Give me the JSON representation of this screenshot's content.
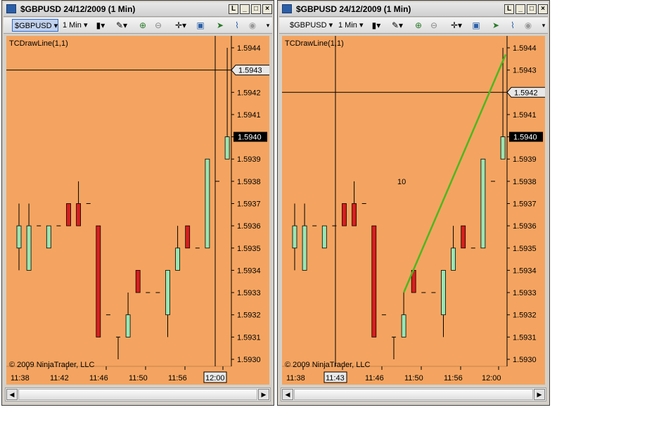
{
  "windows": [
    {
      "title": "$GBPUSD  24/12/2009 (1 Min)",
      "toolbar": {
        "symbol": "$GBPUSD",
        "interval": "1 Min"
      },
      "chart": {
        "indicator_label": "TCDrawLine(1,1)",
        "copyright": "© 2009 NinjaTrader, LLC",
        "price_ticks": [
          "1.5944",
          "1.5943",
          "1.5942",
          "1.5941",
          "1.5940",
          "1.5939",
          "1.5938",
          "1.5937",
          "1.5936",
          "1.5935",
          "1.5934",
          "1.5933",
          "1.5932",
          "1.5931",
          "1.5930"
        ],
        "time_ticks": [
          "11:38",
          "11:42",
          "11:46",
          "11:50",
          "11:56",
          "12:00"
        ],
        "current_price_label": "1.5940",
        "cursor_price_label": "1.5943",
        "cursor_time_label": "12:00",
        "annotation": ""
      }
    },
    {
      "title": "$GBPUSD  24/12/2009 (1 Min)",
      "toolbar": {
        "symbol": "$GBPUSD",
        "interval": "1 Min"
      },
      "chart": {
        "indicator_label": "TCDrawLine(1,1)",
        "copyright": "© 2009 NinjaTrader, LLC",
        "price_ticks": [
          "1.5944",
          "1.5943",
          "1.5942",
          "1.5941",
          "1.5940",
          "1.5939",
          "1.5938",
          "1.5937",
          "1.5936",
          "1.5935",
          "1.5934",
          "1.5933",
          "1.5932",
          "1.5931",
          "1.5930"
        ],
        "time_ticks": [
          "11:38",
          "11:43",
          "11:46",
          "11:50",
          "11:56",
          "12:00"
        ],
        "current_price_label": "1.5940",
        "cursor_price_label": "1.5942",
        "cursor_time_label": "11:43",
        "annotation": "10"
      }
    }
  ],
  "chart_data": [
    {
      "type": "candlestick",
      "title": "$GBPUSD 24/12/2009 (1 Min)",
      "bar_interval": "1 Min",
      "ylim": [
        1.593,
        1.5944
      ],
      "candles": [
        {
          "o": 1.5935,
          "h": 1.5937,
          "l": 1.5934,
          "c": 1.5936
        },
        {
          "o": 1.5934,
          "h": 1.5937,
          "l": 1.5934,
          "c": 1.5936
        },
        {
          "o": 1.5936,
          "h": 1.5936,
          "l": 1.5936,
          "c": 1.5936
        },
        {
          "o": 1.5935,
          "h": 1.5936,
          "l": 1.5935,
          "c": 1.5936
        },
        {
          "o": 1.5936,
          "h": 1.5936,
          "l": 1.5936,
          "c": 1.5936
        },
        {
          "o": 1.5937,
          "h": 1.5937,
          "l": 1.5936,
          "c": 1.5936
        },
        {
          "o": 1.5937,
          "h": 1.5938,
          "l": 1.5936,
          "c": 1.5936
        },
        {
          "o": 1.5937,
          "h": 1.5937,
          "l": 1.5937,
          "c": 1.5937
        },
        {
          "o": 1.5936,
          "h": 1.5936,
          "l": 1.5931,
          "c": 1.5931
        },
        {
          "o": 1.5932,
          "h": 1.5932,
          "l": 1.5932,
          "c": 1.5932
        },
        {
          "o": 1.5931,
          "h": 1.5931,
          "l": 1.593,
          "c": 1.5931
        },
        {
          "o": 1.5931,
          "h": 1.5933,
          "l": 1.5931,
          "c": 1.5932
        },
        {
          "o": 1.5934,
          "h": 1.5934,
          "l": 1.5933,
          "c": 1.5933
        },
        {
          "o": 1.5933,
          "h": 1.5933,
          "l": 1.5933,
          "c": 1.5933
        },
        {
          "o": 1.5933,
          "h": 1.5933,
          "l": 1.5933,
          "c": 1.5933
        },
        {
          "o": 1.5932,
          "h": 1.5934,
          "l": 1.5931,
          "c": 1.5934
        },
        {
          "o": 1.5934,
          "h": 1.5936,
          "l": 1.5934,
          "c": 1.5935
        },
        {
          "o": 1.5936,
          "h": 1.5936,
          "l": 1.5935,
          "c": 1.5935
        },
        {
          "o": 1.5935,
          "h": 1.5935,
          "l": 1.5935,
          "c": 1.5935
        },
        {
          "o": 1.5935,
          "h": 1.5939,
          "l": 1.5935,
          "c": 1.5939
        },
        {
          "o": 1.5938,
          "h": 1.5938,
          "l": 1.5938,
          "c": 1.5938
        },
        {
          "o": 1.5939,
          "h": 1.5944,
          "l": 1.5939,
          "c": 1.594
        }
      ]
    }
  ],
  "colors": {
    "background": "#f4a460",
    "up_candle": "#98e6b4",
    "down_candle": "#d81e1e",
    "draw_line": "#4ab820"
  }
}
